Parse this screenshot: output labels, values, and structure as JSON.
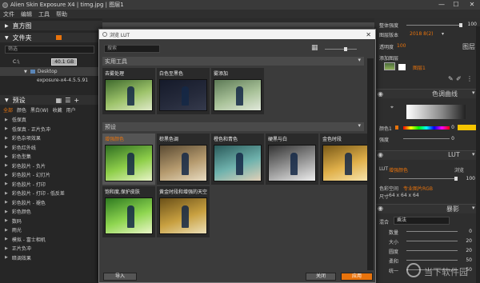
{
  "window": {
    "title": "Alien Skin Exposure X4 | timg.jpg | 图层1",
    "controls": [
      "—",
      "☐",
      "✕"
    ]
  },
  "menu": [
    "文件",
    "编辑",
    "工具",
    "帮助"
  ],
  "left": {
    "histogram_title": "直方图",
    "folder_title": "文件夹",
    "filter_placeholder": "筛选",
    "drive_label": "C:\\",
    "drive_size": "40.1 GB",
    "desktop_label": "Desktop",
    "version_label": "exposure-x4-4.5.5.91",
    "presets_title": "预设",
    "preset_tabs": [
      "全部",
      "颜色",
      "黑白(W)",
      "收藏",
      "用户"
    ],
    "preset_items": [
      "低保真",
      "低保真 - 正片负冲",
      "彩色杂项效果",
      "彩色红外线",
      "彩色型集",
      "彩色胶片 - 负片",
      "彩色胶片 - 幻灯片",
      "彩色胶片 - 打印",
      "彩色胶片 - 打印 - 低反差",
      "彩色胶片 - 褪色",
      "彩色颜色",
      "数码",
      "雨光",
      "模拟 - 富士相机",
      "正片负冲",
      "暗调效果"
    ]
  },
  "modal": {
    "title": "浏览 LUT",
    "search_placeholder": "搜索",
    "section1_title": "实用工具",
    "section1_items": [
      "去雾处理",
      "白色至黑色",
      "雾添加"
    ],
    "section2_title": "预设",
    "section2_items": [
      "增强颜色",
      "棕黑色调",
      "橙色和青色",
      "硬黑与白",
      "金色时段",
      "饱和度,保护皮肤",
      "黄金时段和增强的天空"
    ],
    "import_label": "导入",
    "close_label": "关闭",
    "apply_label": "应用"
  },
  "right": {
    "overall_strength_label": "整体强度",
    "overall_strength_value": "100",
    "layer_version_label": "图层版本",
    "layer_version_value": "2018 8(2)",
    "opacity_label": "透明度",
    "opacity_value": "100",
    "layers_title": "图层",
    "add_layer_label": "添加图层",
    "layer_name": "图层1",
    "curves_title": "色调曲线",
    "color1_label": "颜色1",
    "color1_value": "0",
    "strength_label": "强度",
    "strength_value": "0",
    "lut_title": "LUT",
    "lut_label": "LUT",
    "lut_value": "增强颜色",
    "browse_label": "浏览",
    "lut_strength_value": "100",
    "color_space_label": "色彩空间",
    "color_space_value": "专业图片RGB",
    "size_label": "尺寸",
    "size_value": "64 x 64 x 64",
    "overlay_title": "暴影",
    "blend_label": "混合",
    "blend_value": "乘法",
    "rows": [
      {
        "label": "数量",
        "value": "0"
      },
      {
        "label": "大小",
        "value": "20"
      },
      {
        "label": "圆度",
        "value": "20"
      },
      {
        "label": "柔和",
        "value": "50"
      },
      {
        "label": "统一",
        "value": "50"
      }
    ]
  },
  "watermark": "当下软件园"
}
